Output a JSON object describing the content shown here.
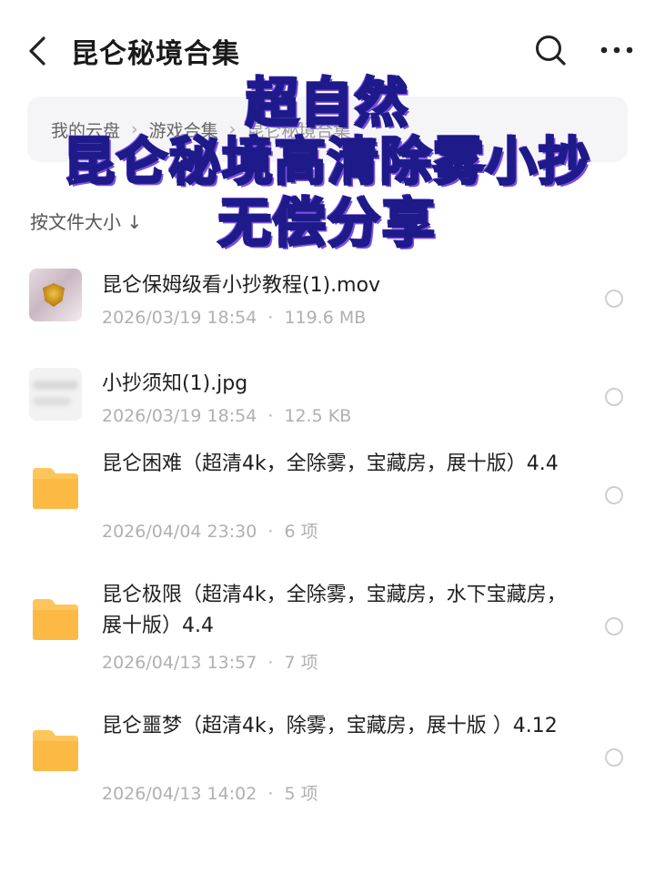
{
  "header": {
    "title": "昆仑秘境合集",
    "back_icon": "chevron-left-icon",
    "search_icon": "search-icon",
    "more_icon": "more-icon"
  },
  "breadcrumb": {
    "items": [
      "我的云盘",
      "游戏合集",
      "昆仑秘境合集"
    ]
  },
  "sort": {
    "label": "按文件大小 ↓"
  },
  "files": [
    {
      "type": "video",
      "name": "昆仑保姆级看小抄教程(1).mov",
      "date": "2026/03/19 18:54",
      "size": "119.6 MB"
    },
    {
      "type": "image",
      "name": "小抄须知(1).jpg",
      "date": "2026/03/19 18:54",
      "size": "12.5 KB"
    },
    {
      "type": "folder",
      "name": "昆仑困难（超清4k，全除雾，宝藏房，展十版）4.4",
      "date": "2026/04/04 23:30",
      "size": "6 项"
    },
    {
      "type": "folder",
      "name": "昆仑极限（超清4k，全除雾，宝藏房，水下宝藏房，展十版）4.4",
      "date": "2026/04/13 13:57",
      "size": "7 项"
    },
    {
      "type": "folder",
      "name": "昆仑噩梦（超清4k，除雾，宝藏房，展十版 ）4.12",
      "date": "2026/04/13 14:02",
      "size": "5 项"
    }
  ],
  "meta_separator": "·",
  "overlay": {
    "line1": "超自然",
    "line2": "昆仑秘境高清除雾小抄",
    "line3": "无偿分享"
  },
  "colors": {
    "folder": "#fdc65a",
    "overlay_stroke": "#1e1a8a",
    "overlay_glow": "#7a4fe0"
  }
}
